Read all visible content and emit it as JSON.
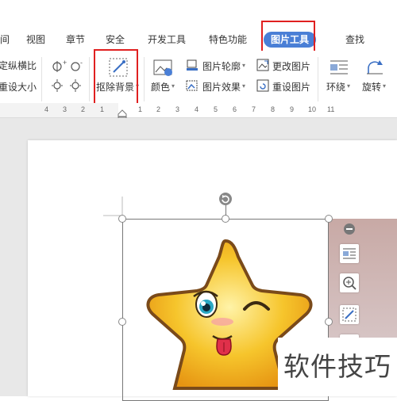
{
  "tabs": [
    {
      "label": "间",
      "active": false
    },
    {
      "label": "视图",
      "active": false
    },
    {
      "label": "章节",
      "active": false
    },
    {
      "label": "安全",
      "active": false
    },
    {
      "label": "开发工具",
      "active": false
    },
    {
      "label": "特色功能",
      "active": false
    },
    {
      "label": "图片工具",
      "active": true
    },
    {
      "label": "查找",
      "active": false
    }
  ],
  "ribbon": {
    "size_group": [
      "定纵横比",
      "重设大小"
    ],
    "remove_bg": "抠除背景",
    "color": "颜色",
    "outline": "图片轮廓",
    "effects": "图片效果",
    "change_pic": "更改图片",
    "reset_pic": "重设图片",
    "wrap": "环绕",
    "rotate": "旋转"
  },
  "ruler": [
    "4",
    "3",
    "2",
    "1",
    "1",
    "2",
    "3",
    "4",
    "5",
    "6",
    "7",
    "8",
    "9",
    "10",
    "11"
  ],
  "watermark": "软件技巧",
  "colors": {
    "accent": "#4a7fd6",
    "highlight": "#e02020",
    "star": "#f4b623",
    "star_outline": "#7a4a1a"
  }
}
